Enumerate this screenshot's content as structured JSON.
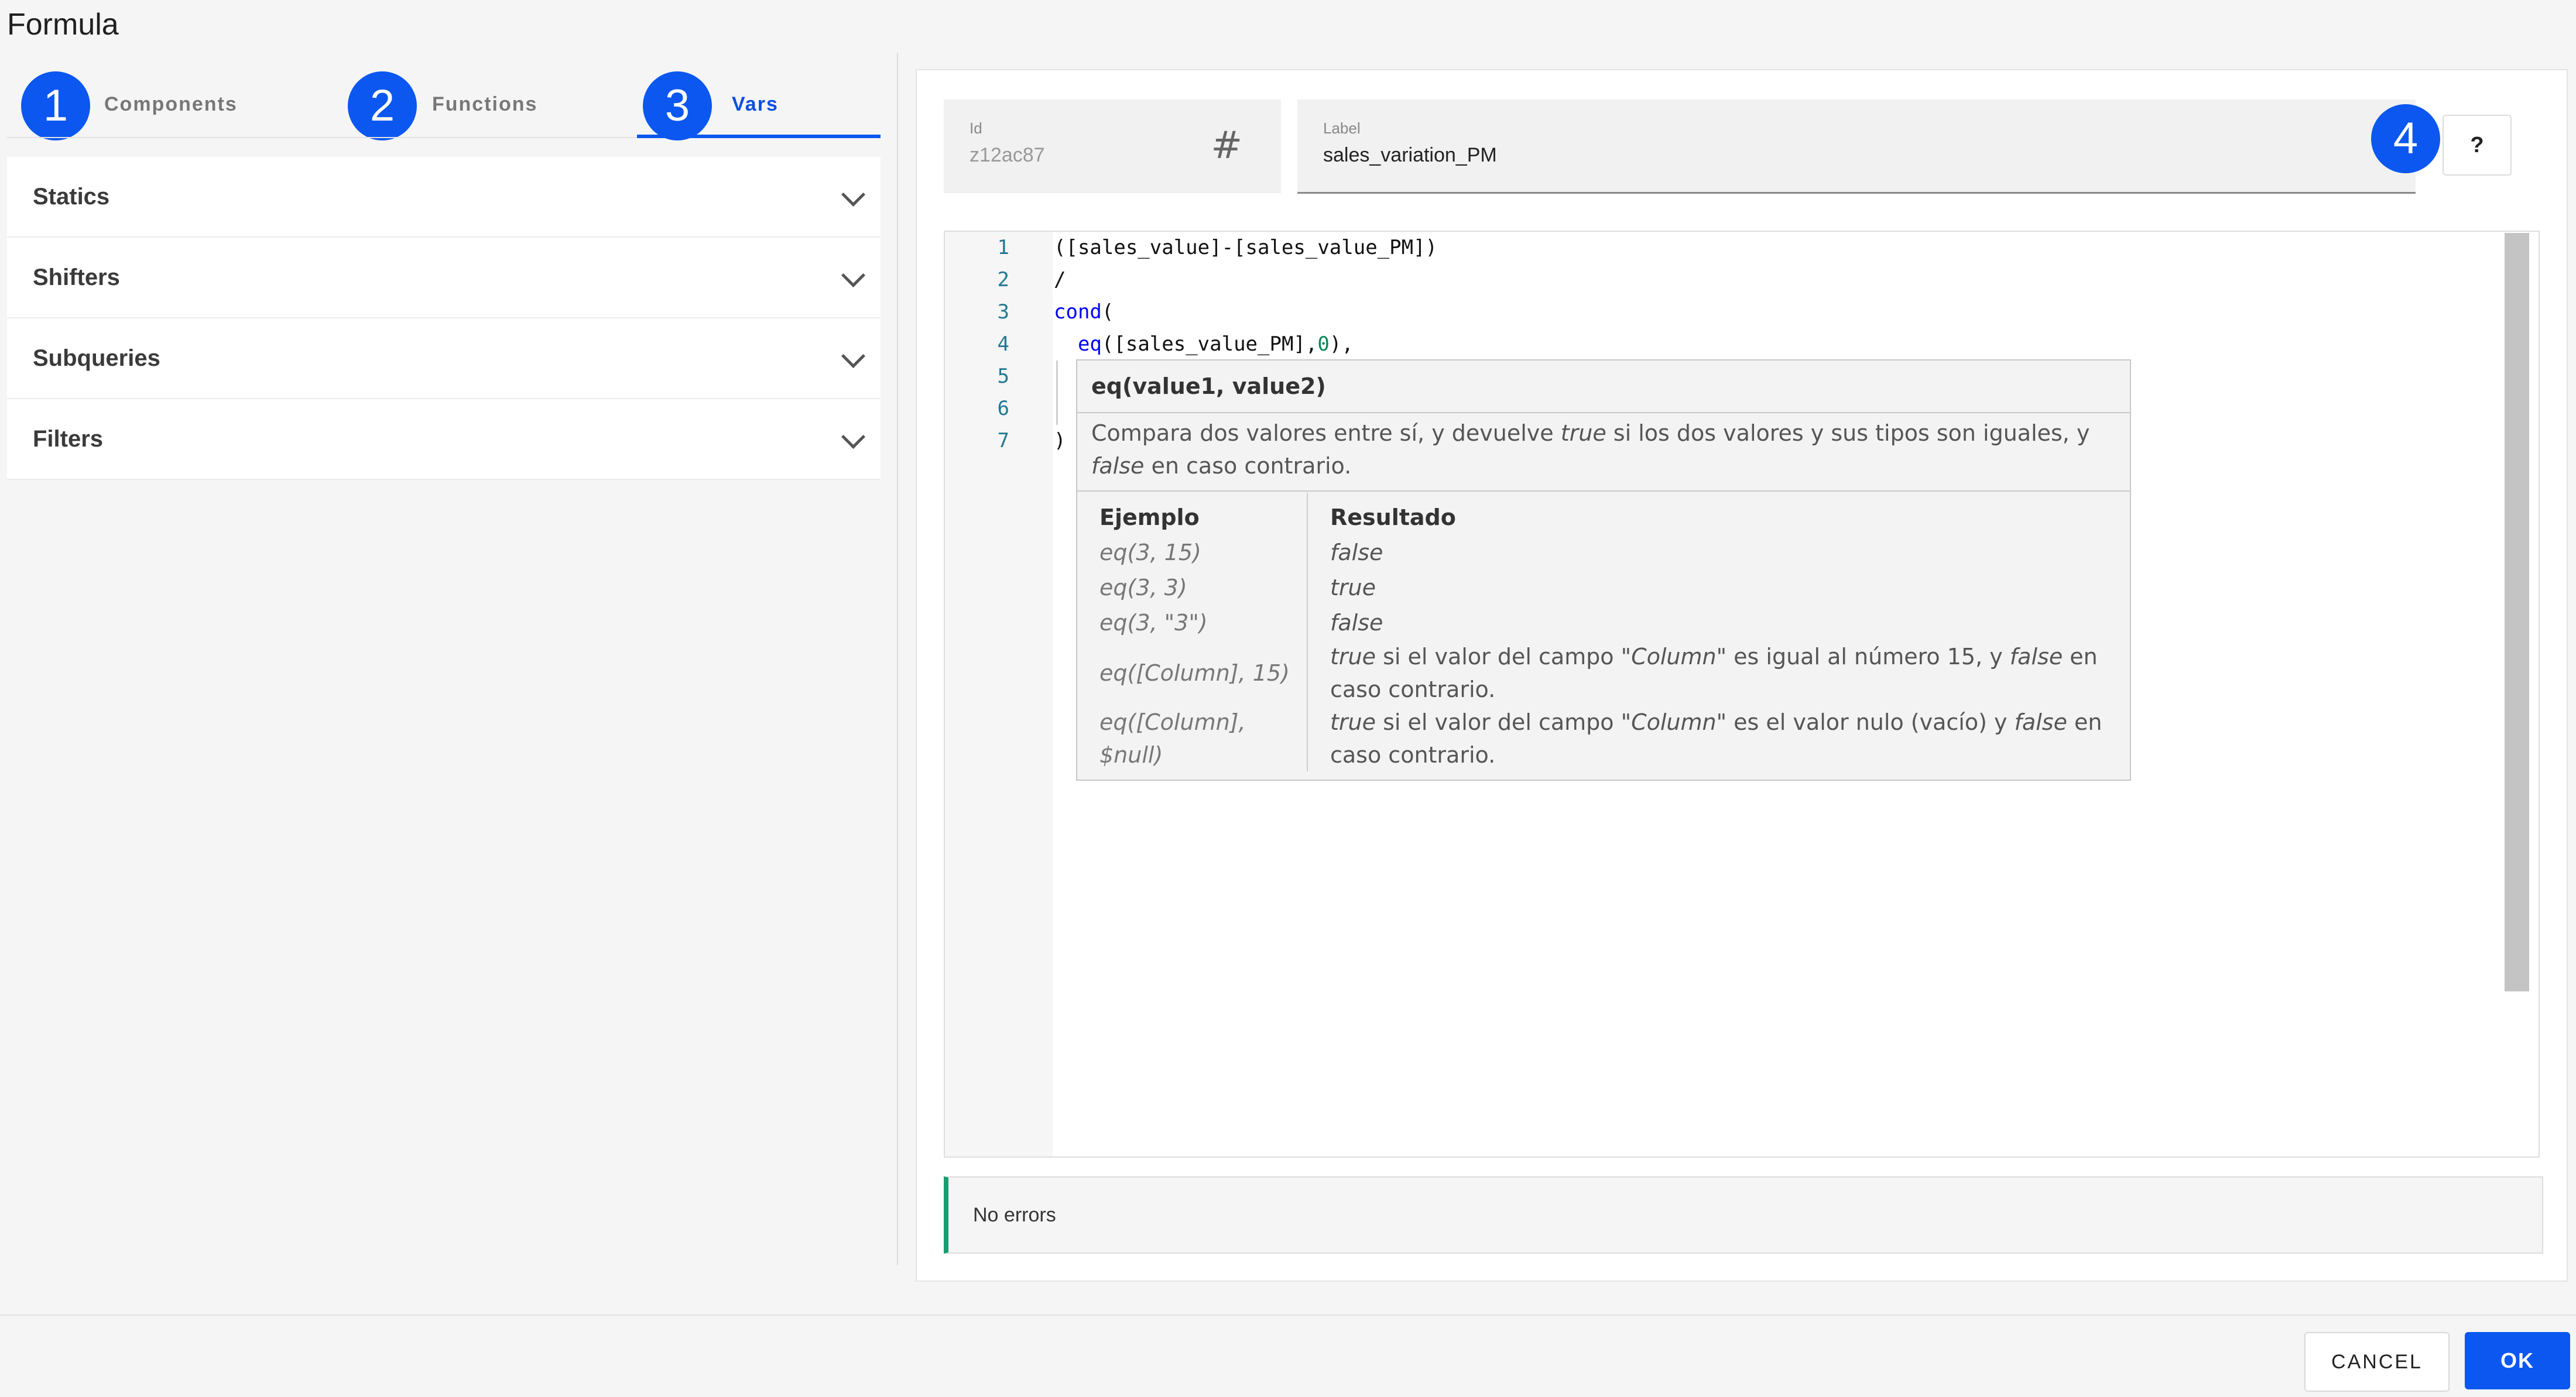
{
  "page_title": "Formula",
  "tabs": [
    {
      "badge": "1",
      "label": "Components",
      "active": false
    },
    {
      "badge": "2",
      "label": "Functions",
      "active": false
    },
    {
      "badge": "3",
      "label": "Vars",
      "active": true
    }
  ],
  "sections": [
    "Statics",
    "Shifters",
    "Subqueries",
    "Filters"
  ],
  "id_field": {
    "caption": "Id",
    "value": "z12ac87",
    "icon": "hash-icon"
  },
  "label_field": {
    "caption": "Label",
    "value": "sales_variation_PM"
  },
  "help": {
    "badge": "4",
    "label": "?"
  },
  "editor": {
    "line_numbers": [
      "1",
      "2",
      "3",
      "4",
      "5",
      "6",
      "7"
    ],
    "lines": [
      "([sales_value]-[sales_value_PM])",
      "/",
      "cond(",
      "  eq([sales_value_PM],0),",
      "",
      "",
      ")"
    ]
  },
  "tooltip": {
    "signature": "eq(value1, value2)",
    "description": {
      "p1": "Compara dos valores entre sí, y devuelve ",
      "true": "true",
      "p2": " si los dos valores y sus tipos son iguales, y ",
      "false": "false",
      "p3": " en caso contrario."
    },
    "table_headers": [
      "Ejemplo",
      "Resultado"
    ],
    "rows": [
      {
        "example": "eq(3, 15)",
        "result": "false"
      },
      {
        "example": "eq(3, 3)",
        "result": "true"
      },
      {
        "example": "eq(3, \"3\")",
        "result": "false"
      },
      {
        "example": "eq([Column], 15)",
        "r_true": "true",
        "r1": " si el valor del campo \"",
        "r_col": "Column",
        "r2": "\" es igual al número 15, y ",
        "r_false": "false",
        "r3": " en caso contrario."
      },
      {
        "example": "eq([Column], $null)",
        "r_true": "true",
        "r1": " si el valor del campo \"",
        "r_col": "Column",
        "r2": "\" es el valor nulo (vacío) y ",
        "r_false": "false",
        "r3": " en caso contrario."
      }
    ]
  },
  "status": "No errors",
  "footer": {
    "cancel": "CANCEL",
    "ok": "OK"
  },
  "colors": {
    "accent": "#0b57f0",
    "status_ok": "#1a9c72"
  }
}
